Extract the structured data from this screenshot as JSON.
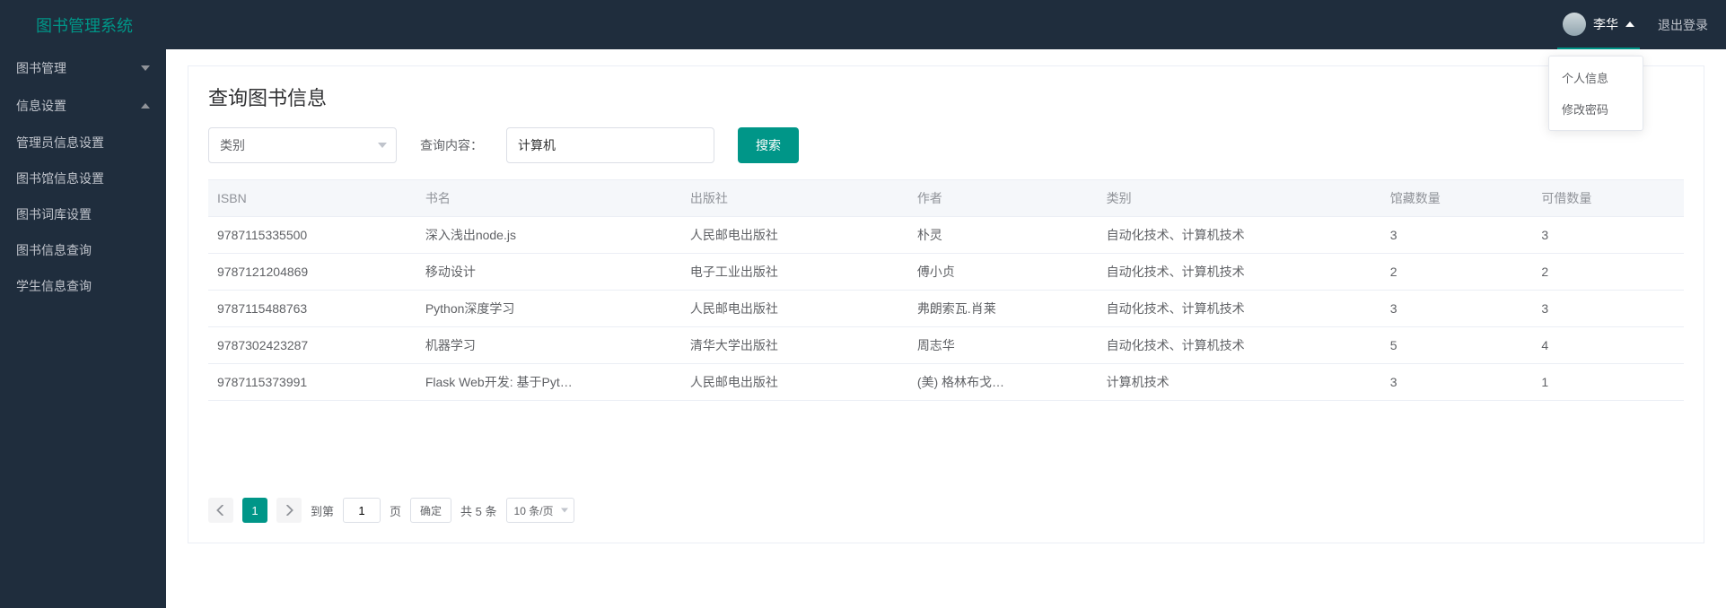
{
  "header": {
    "brand": "图书管理系统",
    "username": "李华",
    "logout": "退出登录",
    "user_menu": [
      "个人信息",
      "修改密码"
    ]
  },
  "sidebar": {
    "groups": [
      {
        "title": "图书管理",
        "expanded": false,
        "items": []
      },
      {
        "title": "信息设置",
        "expanded": true,
        "items": [
          "管理员信息设置",
          "图书馆信息设置",
          "图书词库设置",
          "图书信息查询",
          "学生信息查询"
        ]
      }
    ]
  },
  "page": {
    "title": "查询图书信息",
    "filter_label": "类别",
    "query_label": "查询内容：",
    "query_value": "计算机",
    "search_btn": "搜索"
  },
  "table": {
    "columns": [
      "ISBN",
      "书名",
      "出版社",
      "作者",
      "类别",
      "馆藏数量",
      "可借数量"
    ],
    "rows": [
      [
        "9787115335500",
        "深入浅出node.js",
        "人民邮电出版社",
        "朴灵",
        "自动化技术、计算机技术",
        "3",
        "3"
      ],
      [
        "9787121204869",
        "移动设计",
        "电子工业出版社",
        "傅小贞",
        "自动化技术、计算机技术",
        "2",
        "2"
      ],
      [
        "9787115488763",
        "Python深度学习",
        "人民邮电出版社",
        "弗朗索瓦.肖莱",
        "自动化技术、计算机技术",
        "3",
        "3"
      ],
      [
        "9787302423287",
        "机器学习",
        "清华大学出版社",
        "周志华",
        "自动化技术、计算机技术",
        "5",
        "4"
      ],
      [
        "9787115373991",
        "Flask Web开发: 基于Pyt…",
        "人民邮电出版社",
        "(美) 格林布戈…",
        "计算机技术",
        "3",
        "1"
      ]
    ]
  },
  "pager": {
    "current": "1",
    "goto_prefix": "到第",
    "goto_input": "1",
    "goto_suffix": "页",
    "confirm": "确定",
    "total": "共 5 条",
    "page_size": "10 条/页"
  }
}
